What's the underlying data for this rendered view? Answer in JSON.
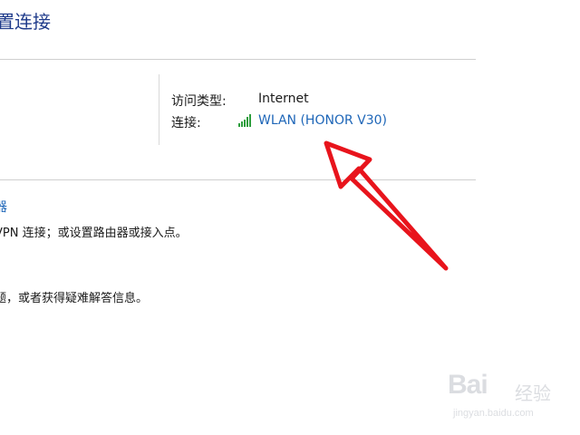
{
  "header": {
    "title": "置连接"
  },
  "network_info": {
    "access_type_label": "访问类型:",
    "access_type_value": "Internet",
    "connection_label": "连接:",
    "connection_value": "WLAN (HONOR V30)",
    "signal_icon": "wifi-signal-bars-icon"
  },
  "section": {
    "link_text": "器",
    "description1": "VPN 连接；或设置路由器或接入点。",
    "description2": "题，或者获得疑难解答信息。"
  },
  "watermark": {
    "logo": "Bai",
    "text": "经验",
    "url": "jingyan.baidu.com"
  },
  "colors": {
    "link": "#1e66b8",
    "title": "#1e3a8a",
    "annotation_arrow": "#e8141c",
    "signal": "#2e9e3e"
  }
}
